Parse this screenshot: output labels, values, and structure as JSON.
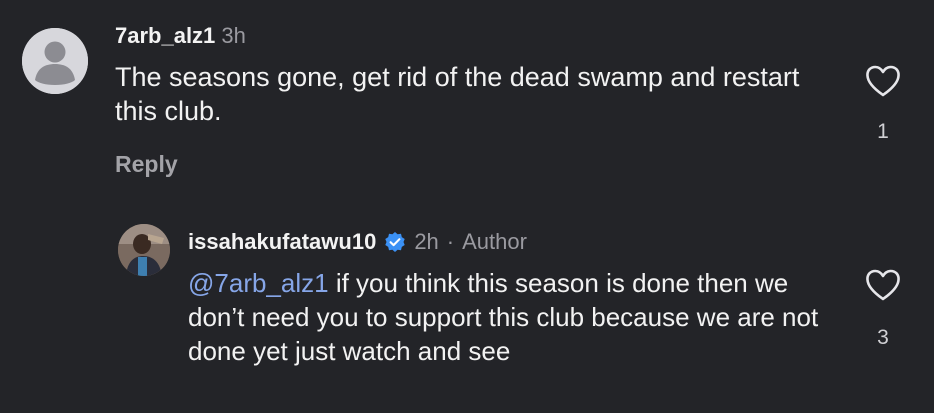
{
  "comment": {
    "username": "7arb_alz1",
    "time": "3h",
    "text": "The seasons gone, get rid of the dead swamp and restart this club.",
    "reply_label": "Reply",
    "like_count": "1"
  },
  "reply": {
    "username": "issahakufatawu10",
    "time": "2h",
    "separator": "·",
    "role": "Author",
    "mention": "@7arb_alz1",
    "text": " if you think this season is done then we don’t need you to support this club because we are not done yet just watch and see",
    "like_count": "3"
  },
  "colors": {
    "background": "#232428",
    "mention": "#86a6e8",
    "verified_badge": "#3b91f5"
  },
  "icons": [
    "default-avatar-icon",
    "heart-outline-icon",
    "verified-badge-icon"
  ]
}
